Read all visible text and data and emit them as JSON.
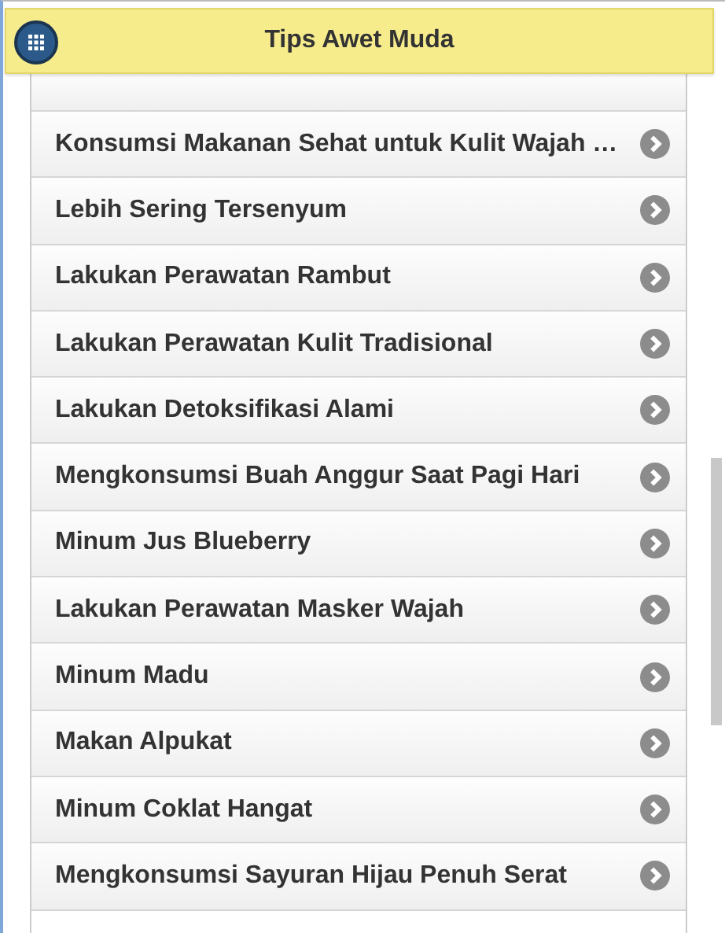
{
  "header": {
    "title": "Tips Awet Muda"
  },
  "items": [
    {
      "label": "Konsumsi Makanan Sehat untuk Kulit Wajah …"
    },
    {
      "label": "Lebih Sering Tersenyum"
    },
    {
      "label": "Lakukan Perawatan Rambut"
    },
    {
      "label": "Lakukan Perawatan Kulit Tradisional"
    },
    {
      "label": "Lakukan Detoksifikasi Alami"
    },
    {
      "label": "Mengkonsumsi Buah Anggur Saat Pagi Hari"
    },
    {
      "label": "Minum Jus Blueberry"
    },
    {
      "label": "Lakukan Perawatan Masker Wajah"
    },
    {
      "label": "Minum Madu"
    },
    {
      "label": "Makan Alpukat"
    },
    {
      "label": "Minum Coklat Hangat"
    },
    {
      "label": "Mengkonsumsi Sayuran Hijau Penuh Serat"
    }
  ]
}
